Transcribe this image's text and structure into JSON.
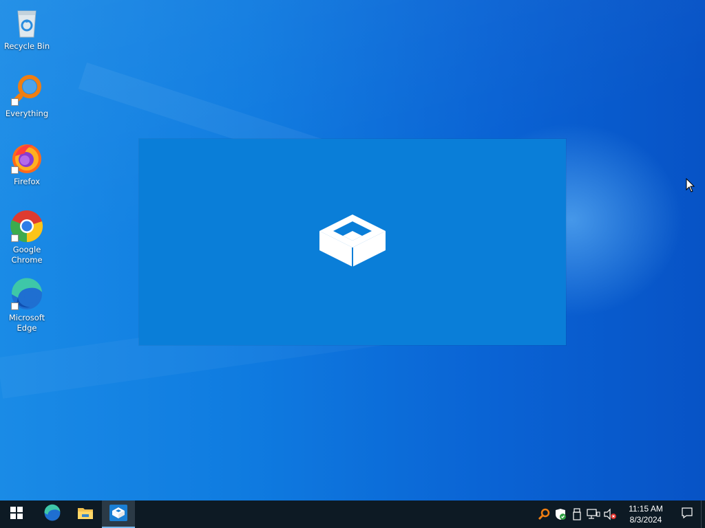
{
  "desktop": {
    "icons": [
      {
        "label": "Recycle Bin",
        "icon": "recycle-bin-icon"
      },
      {
        "label": "Everything",
        "icon": "everything-search-icon"
      },
      {
        "label": "Firefox",
        "icon": "firefox-icon"
      },
      {
        "label": "Google Chrome",
        "icon": "chrome-icon"
      },
      {
        "label": "Microsoft Edge",
        "icon": "edge-icon"
      }
    ]
  },
  "splash": {
    "icon": "sandbox-box-icon",
    "background": "#0a7ed8"
  },
  "taskbar": {
    "items": [
      {
        "name": "start",
        "icon": "windows-logo-icon"
      },
      {
        "name": "edge",
        "icon": "edge-icon"
      },
      {
        "name": "file-explorer",
        "icon": "folder-icon"
      },
      {
        "name": "windows-sandbox",
        "icon": "sandbox-box-icon",
        "active": true
      }
    ],
    "tray": {
      "icons": [
        "everything-search-icon",
        "windows-security-icon",
        "usb-device-icon",
        "network-icon",
        "volume-muted-icon"
      ],
      "time": "11:15 AM",
      "date": "8/3/2024"
    },
    "accent": "#76b9ed"
  }
}
